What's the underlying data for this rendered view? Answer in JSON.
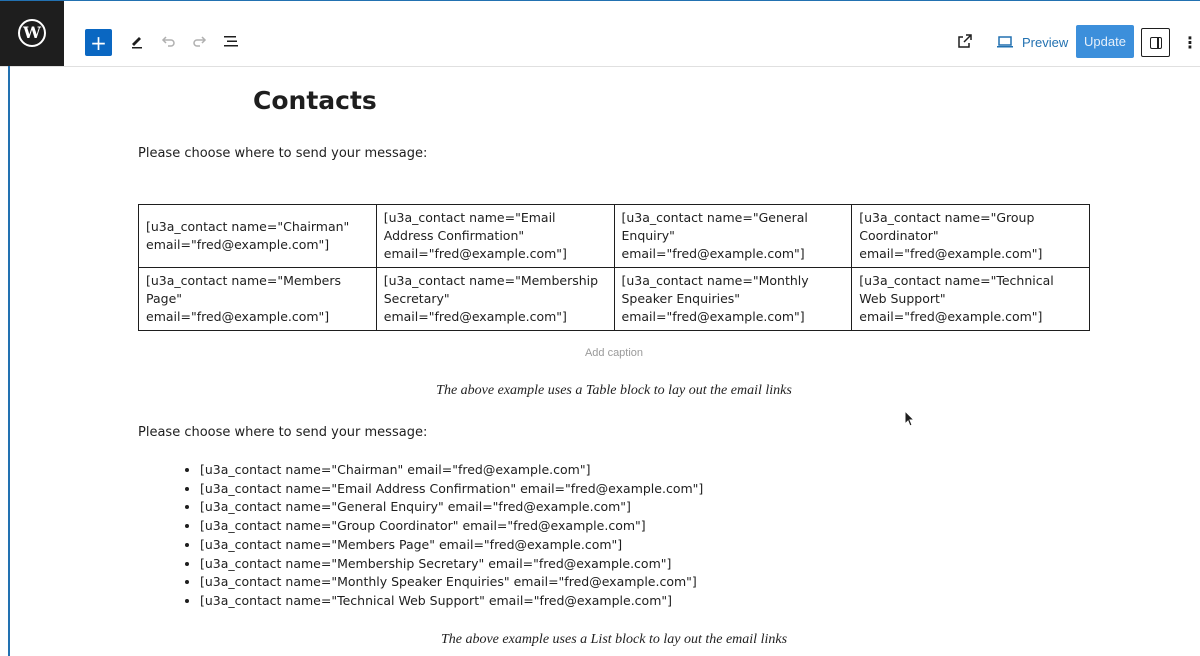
{
  "toolbar": {
    "logo": "W",
    "add_icon": "+",
    "preview_label": "Preview",
    "update_label": "Update"
  },
  "page": {
    "title": "Contacts",
    "intro_1": "Please choose where to send your message:",
    "caption": "Add caption",
    "table_note": "The above example uses a Table block to lay out the email links",
    "intro_2": "Please choose where to send your message:",
    "list_note": "The above example uses a List block to lay out the email links"
  },
  "table": {
    "rows": [
      [
        "[u3a_contact name=\"Chairman\" email=\"fred@example.com\"]",
        "[u3a_contact name=\"Email Address Confirmation\" email=\"fred@example.com\"]",
        "[u3a_contact name=\"General Enquiry\" email=\"fred@example.com\"]",
        "[u3a_contact name=\"Group Coordinator\" email=\"fred@example.com\"]"
      ],
      [
        "[u3a_contact name=\"Members Page\" email=\"fred@example.com\"]",
        "[u3a_contact name=\"Membership Secretary\" email=\"fred@example.com\"]",
        "[u3a_contact name=\"Monthly Speaker Enquiries\" email=\"fred@example.com\"]",
        "[u3a_contact name=\"Technical Web Support\" email=\"fred@example.com\"]"
      ]
    ]
  },
  "list": {
    "items": [
      "[u3a_contact name=\"Chairman\" email=\"fred@example.com\"]",
      "[u3a_contact name=\"Email Address Confirmation\" email=\"fred@example.com\"]",
      "[u3a_contact name=\"General Enquiry\" email=\"fred@example.com\"]",
      "[u3a_contact name=\"Group Coordinator\" email=\"fred@example.com\"]",
      "[u3a_contact name=\"Members Page\" email=\"fred@example.com\"]",
      "[u3a_contact name=\"Membership Secretary\" email=\"fred@example.com\"]",
      "[u3a_contact name=\"Monthly Speaker Enquiries\" email=\"fred@example.com\"]",
      "[u3a_contact name=\"Technical Web Support\" email=\"fred@example.com\"]"
    ]
  }
}
